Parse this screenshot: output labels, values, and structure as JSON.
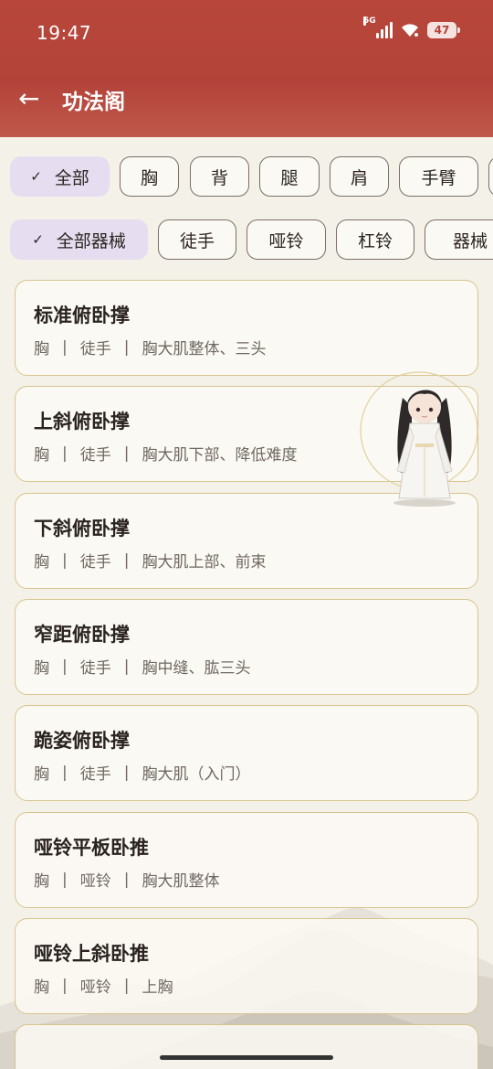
{
  "status_bar": {
    "time": "19:47",
    "network": "5G",
    "battery": "47"
  },
  "header": {
    "back_icon": "←",
    "title": "功法阁"
  },
  "muscle_filters": [
    {
      "label": "全部",
      "active": true
    },
    {
      "label": "胸",
      "active": false
    },
    {
      "label": "背",
      "active": false
    },
    {
      "label": "腿",
      "active": false
    },
    {
      "label": "肩",
      "active": false
    },
    {
      "label": "手臂",
      "active": false
    }
  ],
  "equipment_filters": [
    {
      "label": "全部器械",
      "active": true
    },
    {
      "label": "徒手",
      "active": false
    },
    {
      "label": "哑铃",
      "active": false
    },
    {
      "label": "杠铃",
      "active": false
    },
    {
      "label": "器械",
      "active": false
    }
  ],
  "check_icon": "✓",
  "exercises": [
    {
      "name": "标准俯卧撑",
      "part": "胸",
      "equipment": "徒手",
      "target": "胸大肌整体、三头"
    },
    {
      "name": "上斜俯卧撑",
      "part": "胸",
      "equipment": "徒手",
      "target": "胸大肌下部、降低难度"
    },
    {
      "name": "下斜俯卧撑",
      "part": "胸",
      "equipment": "徒手",
      "target": "胸大肌上部、前束"
    },
    {
      "name": "窄距俯卧撑",
      "part": "胸",
      "equipment": "徒手",
      "target": "胸中缝、肱三头"
    },
    {
      "name": "跪姿俯卧撑",
      "part": "胸",
      "equipment": "徒手",
      "target": "胸大肌（入门）"
    },
    {
      "name": "哑铃平板卧推",
      "part": "胸",
      "equipment": "哑铃",
      "target": "胸大肌整体"
    },
    {
      "name": "哑铃上斜卧推",
      "part": "胸",
      "equipment": "哑铃",
      "target": "上胸"
    }
  ],
  "separator": "|",
  "colors": {
    "header_red": "#b3433a",
    "card_border": "#d8c48f",
    "chip_active": "#e6def0",
    "background": "#f4f1e8"
  }
}
